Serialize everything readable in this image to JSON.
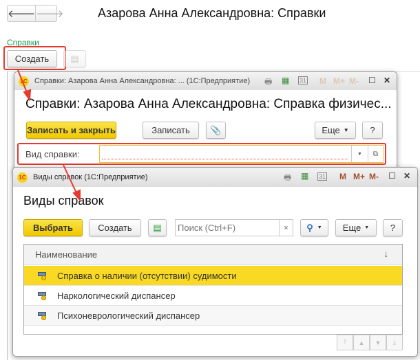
{
  "main": {
    "back_icon": "arrow-left",
    "forward_icon": "arrow-right",
    "title": "Азарова Анна Александровна: Справки",
    "section_link": "Справки",
    "create_label": "Создать"
  },
  "window1": {
    "caption": "Справки: Азарова Анна Александровна: ...  (1С:Предприятие)",
    "title": "Справки: Азарова Анна Александровна: Справка физичес...",
    "save_close_label": "Записать и закрыть",
    "save_label": "Записать",
    "more_label": "Еще",
    "help_label": "?",
    "field_label": "Вид справки:",
    "field_value": "",
    "m": "M",
    "mplus": "M+",
    "mminus": "M-",
    "calendar_day": "31"
  },
  "window2": {
    "caption": "Виды справок  (1С:Предприятие)",
    "title": "Виды справок",
    "select_label": "Выбрать",
    "create_label": "Создать",
    "search_placeholder": "Поиск (Ctrl+F)",
    "clear_label": "×",
    "more_label": "Еще",
    "help_label": "?",
    "m": "M",
    "mplus": "M+",
    "mminus": "M-",
    "calendar_day": "31",
    "table": {
      "column": "Наименование",
      "sort_indicator": "↓",
      "rows": [
        {
          "name": "Справка о наличии (отсутствии) судимости",
          "selected": true
        },
        {
          "name": "Наркологический диспансер",
          "selected": false
        },
        {
          "name": "Психоневрологический диспансер",
          "selected": false
        }
      ]
    }
  },
  "colors": {
    "accent_yellow": "#f5d21a",
    "highlight_red": "#e53a2f",
    "link_green": "#1a9e4b"
  }
}
